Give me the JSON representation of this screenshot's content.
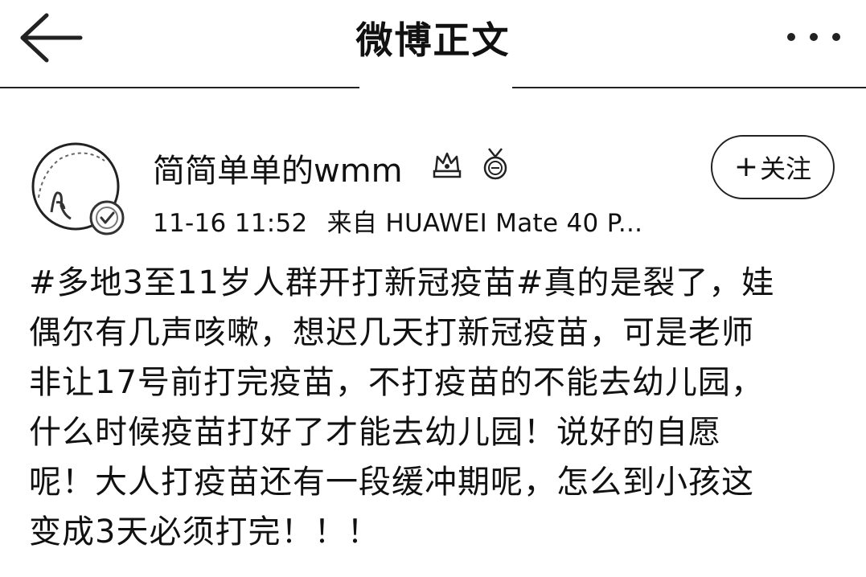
{
  "header": {
    "title": "微博正文"
  },
  "author": {
    "name": "简简单单的wmm"
  },
  "meta": {
    "time": "11-16 11:52",
    "source": "来自 HUAWEI Mate 40 P..."
  },
  "follow": {
    "plus": "+",
    "label": "关注"
  },
  "post": {
    "lines": [
      "#多地3至11岁人群开打新冠疫苗#真的是裂了，娃",
      "偶尔有几声咳嗽，想迟几天打新冠疫苗，可是老师",
      "非让17号前打完疫苗，不打疫苗的不能去幼儿园，",
      "什么时候疫苗打好了才能去幼儿园！说好的自愿",
      "呢！大人打疫苗还有一段缓冲期呢，怎么到小孩这",
      "变成3天必须打完！！！"
    ]
  },
  "icons": {
    "back": "arrow-left-icon",
    "more": "more-dots-icon",
    "badge1": "crown-badge-icon",
    "badge2": "medal-badge-icon",
    "verified": "verified-check-icon"
  },
  "colors": {
    "text": "#111111",
    "background": "#ffffff"
  }
}
